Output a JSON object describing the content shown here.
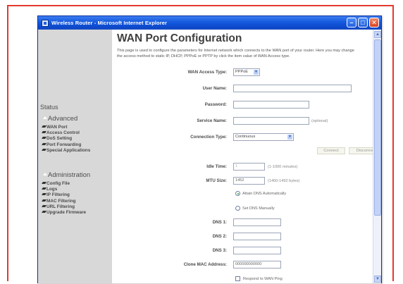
{
  "window": {
    "title": "Wireless Router - Microsoft Internet Explorer",
    "controls": [
      "minimize",
      "maximize",
      "close"
    ]
  },
  "sidebar": {
    "status_label": "Status",
    "advanced": {
      "label": "Advanced",
      "items": [
        "WAN Port",
        "Access Control",
        "DoS Setting",
        "Port Forwarding",
        "Special Applications"
      ]
    },
    "administration": {
      "label": "Administration",
      "items": [
        "Config File",
        "Logs",
        "IP Filtering",
        "MAC Filtering",
        "URL Filtering",
        "Upgrade Firmware"
      ]
    }
  },
  "main": {
    "title": "WAN Port Configuration",
    "intro": "This page is used to configure the parameters for Internet network which connects to the WAN port of your router. Here you may change the access method to static IP, DHCP, PPPoE or PPTP by click the item value of WAN Access type.",
    "form": {
      "wan_access_type": {
        "label": "WAN Access Type:",
        "value": "PPPoE"
      },
      "user_name": {
        "label": "User Name:",
        "value": ""
      },
      "password": {
        "label": "Password:",
        "value": ""
      },
      "service_name": {
        "label": "Service Name:",
        "value": "",
        "hint": "(optional)"
      },
      "connection_type": {
        "label": "Connection Type:",
        "value": "Continuous"
      },
      "connect_button": "Connect",
      "disconnect_button": "Disconnect",
      "idle_time": {
        "label": "Idle Time:",
        "value": "1",
        "hint": "(1-1000 minutes)"
      },
      "mtu_size": {
        "label": "MTU Size:",
        "value": "1452",
        "hint": "(1400-1492 bytes)"
      },
      "dns_auto": {
        "label": "Attain DNS Automatically",
        "checked": true
      },
      "dns_manual": {
        "label": "Set DNS Manually",
        "checked": false
      },
      "dns1": {
        "label": "DNS 1:",
        "value": ""
      },
      "dns2": {
        "label": "DNS 2:",
        "value": ""
      },
      "dns3": {
        "label": "DNS 3:",
        "value": ""
      },
      "clone_mac": {
        "label": "Clone MAC Address:",
        "value": "000000000000"
      },
      "respond_wan_ping": {
        "label": "Respond to WAN Ping",
        "checked": false
      }
    }
  },
  "colors": {
    "frame_border": "#e23a2e",
    "titlebar": "#1559de",
    "sidebar_bg": "#d8d8d8"
  }
}
